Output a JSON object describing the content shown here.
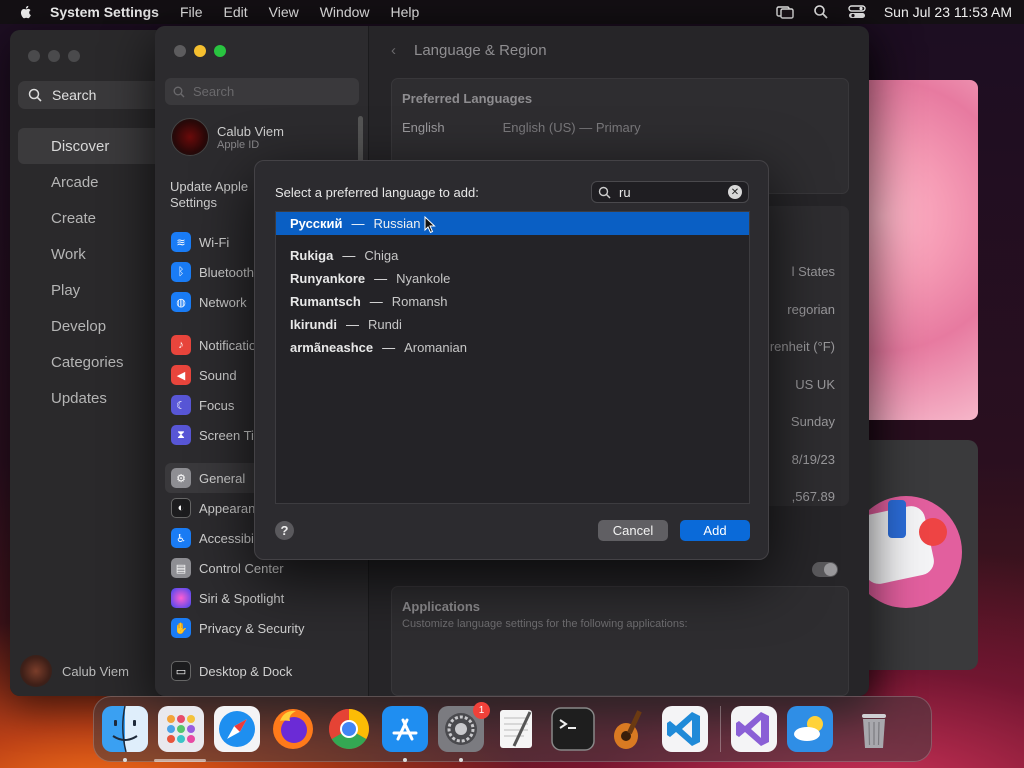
{
  "menubar": {
    "app_name": "System Settings",
    "menus": [
      "File",
      "Edit",
      "View",
      "Window",
      "Help"
    ],
    "clock": "Sun Jul 23  11:53 AM"
  },
  "appstore": {
    "search_label": "Search",
    "nav": [
      "Discover",
      "Arcade",
      "Create",
      "Work",
      "Play",
      "Develop",
      "Categories",
      "Updates"
    ],
    "active_nav": "Discover",
    "user_name": "Calub Viem"
  },
  "settings": {
    "search_placeholder": "Search",
    "user_name": "Calub Viem",
    "user_sub": "Apple ID",
    "update_text": "Update Apple\nSettings",
    "sidebar_groups": [
      [
        {
          "label": "Wi-Fi",
          "icon": "wifi-icon",
          "color": "#1a7cf5"
        },
        {
          "label": "Bluetooth",
          "icon": "bluetooth-icon",
          "color": "#1a7cf5"
        },
        {
          "label": "Network",
          "icon": "globe-icon",
          "color": "#1a7cf5"
        }
      ],
      [
        {
          "label": "Notifications",
          "icon": "bell-icon",
          "color": "#e8453c"
        },
        {
          "label": "Sound",
          "icon": "speaker-icon",
          "color": "#e8453c"
        },
        {
          "label": "Focus",
          "icon": "moon-icon",
          "color": "#5856d6"
        },
        {
          "label": "Screen Time",
          "icon": "hourglass-icon",
          "color": "#5856d6"
        }
      ],
      [
        {
          "label": "General",
          "icon": "gear-icon",
          "color": "#8e8e93"
        },
        {
          "label": "Appearance",
          "icon": "appearance-icon",
          "color": "#1c1c1e"
        },
        {
          "label": "Accessibility",
          "icon": "accessibility-icon",
          "color": "#1a7cf5"
        },
        {
          "label": "Control Center",
          "icon": "control-center-icon",
          "color": "#8e8e93"
        },
        {
          "label": "Siri & Spotlight",
          "icon": "siri-icon",
          "color": "#c43cb4"
        },
        {
          "label": "Privacy & Security",
          "icon": "hand-icon",
          "color": "#1a7cf5"
        }
      ],
      [
        {
          "label": "Desktop & Dock",
          "icon": "dock-icon",
          "color": "#1c1c1e"
        }
      ]
    ],
    "page_title": "Language & Region",
    "preferred_title": "Preferred Languages",
    "preferred_row": {
      "name": "English",
      "detail": "English (US) — Primary"
    },
    "region_values": [
      "l States",
      "regorian",
      "renheit (°F)",
      "US   UK",
      "Sunday",
      "8/19/23",
      ",567.89"
    ],
    "applications_title": "Applications",
    "applications_sub": "Customize language settings for the following applications:"
  },
  "modal": {
    "prompt": "Select a preferred language to add:",
    "search_value": "ru",
    "languages": [
      {
        "native": "Русский",
        "english": "Russian",
        "selected": true
      },
      {
        "native": "Rukiga",
        "english": "Chiga",
        "selected": false
      },
      {
        "native": "Runyankore",
        "english": "Nyankole",
        "selected": false
      },
      {
        "native": "Rumantsch",
        "english": "Romansh",
        "selected": false
      },
      {
        "native": "Ikirundi",
        "english": "Rundi",
        "selected": false
      },
      {
        "native": "armãneashce",
        "english": "Aromanian",
        "selected": false
      }
    ],
    "help_label": "?",
    "cancel_label": "Cancel",
    "add_label": "Add"
  },
  "dock": {
    "apps": [
      {
        "name": "finder-icon",
        "running": true
      },
      {
        "name": "launchpad-icon",
        "running": false
      },
      {
        "name": "safari-icon",
        "running": false
      },
      {
        "name": "firefox-icon",
        "running": false
      },
      {
        "name": "chrome-icon",
        "running": false
      },
      {
        "name": "app-store-icon",
        "running": true
      },
      {
        "name": "system-settings-icon",
        "running": true,
        "badge": "1"
      },
      {
        "name": "textedit-icon",
        "running": false
      },
      {
        "name": "terminal-icon",
        "running": false
      },
      {
        "name": "garageband-icon",
        "running": false
      },
      {
        "name": "vscode-icon",
        "running": false
      },
      {
        "name": "visual-studio-icon",
        "running": false
      },
      {
        "name": "weather-icon",
        "running": false
      },
      {
        "name": "trash-icon",
        "running": false
      }
    ]
  }
}
